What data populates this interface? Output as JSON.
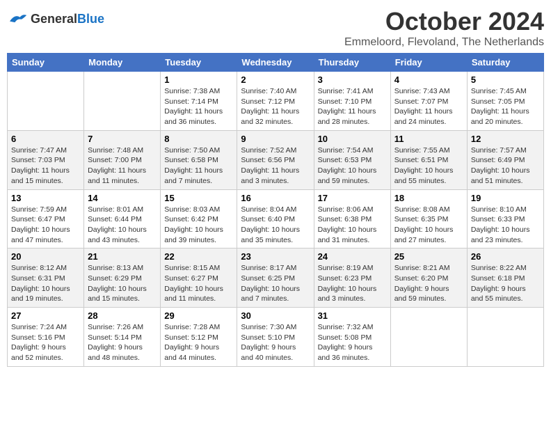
{
  "header": {
    "logo_general": "General",
    "logo_blue": "Blue",
    "month_title": "October 2024",
    "location": "Emmeloord, Flevoland, The Netherlands"
  },
  "days_of_week": [
    "Sunday",
    "Monday",
    "Tuesday",
    "Wednesday",
    "Thursday",
    "Friday",
    "Saturday"
  ],
  "weeks": [
    {
      "days": [
        {
          "num": "",
          "info": ""
        },
        {
          "num": "",
          "info": ""
        },
        {
          "num": "1",
          "info": "Sunrise: 7:38 AM\nSunset: 7:14 PM\nDaylight: 11 hours\nand 36 minutes."
        },
        {
          "num": "2",
          "info": "Sunrise: 7:40 AM\nSunset: 7:12 PM\nDaylight: 11 hours\nand 32 minutes."
        },
        {
          "num": "3",
          "info": "Sunrise: 7:41 AM\nSunset: 7:10 PM\nDaylight: 11 hours\nand 28 minutes."
        },
        {
          "num": "4",
          "info": "Sunrise: 7:43 AM\nSunset: 7:07 PM\nDaylight: 11 hours\nand 24 minutes."
        },
        {
          "num": "5",
          "info": "Sunrise: 7:45 AM\nSunset: 7:05 PM\nDaylight: 11 hours\nand 20 minutes."
        }
      ]
    },
    {
      "days": [
        {
          "num": "6",
          "info": "Sunrise: 7:47 AM\nSunset: 7:03 PM\nDaylight: 11 hours\nand 15 minutes."
        },
        {
          "num": "7",
          "info": "Sunrise: 7:48 AM\nSunset: 7:00 PM\nDaylight: 11 hours\nand 11 minutes."
        },
        {
          "num": "8",
          "info": "Sunrise: 7:50 AM\nSunset: 6:58 PM\nDaylight: 11 hours\nand 7 minutes."
        },
        {
          "num": "9",
          "info": "Sunrise: 7:52 AM\nSunset: 6:56 PM\nDaylight: 11 hours\nand 3 minutes."
        },
        {
          "num": "10",
          "info": "Sunrise: 7:54 AM\nSunset: 6:53 PM\nDaylight: 10 hours\nand 59 minutes."
        },
        {
          "num": "11",
          "info": "Sunrise: 7:55 AM\nSunset: 6:51 PM\nDaylight: 10 hours\nand 55 minutes."
        },
        {
          "num": "12",
          "info": "Sunrise: 7:57 AM\nSunset: 6:49 PM\nDaylight: 10 hours\nand 51 minutes."
        }
      ]
    },
    {
      "days": [
        {
          "num": "13",
          "info": "Sunrise: 7:59 AM\nSunset: 6:47 PM\nDaylight: 10 hours\nand 47 minutes."
        },
        {
          "num": "14",
          "info": "Sunrise: 8:01 AM\nSunset: 6:44 PM\nDaylight: 10 hours\nand 43 minutes."
        },
        {
          "num": "15",
          "info": "Sunrise: 8:03 AM\nSunset: 6:42 PM\nDaylight: 10 hours\nand 39 minutes."
        },
        {
          "num": "16",
          "info": "Sunrise: 8:04 AM\nSunset: 6:40 PM\nDaylight: 10 hours\nand 35 minutes."
        },
        {
          "num": "17",
          "info": "Sunrise: 8:06 AM\nSunset: 6:38 PM\nDaylight: 10 hours\nand 31 minutes."
        },
        {
          "num": "18",
          "info": "Sunrise: 8:08 AM\nSunset: 6:35 PM\nDaylight: 10 hours\nand 27 minutes."
        },
        {
          "num": "19",
          "info": "Sunrise: 8:10 AM\nSunset: 6:33 PM\nDaylight: 10 hours\nand 23 minutes."
        }
      ]
    },
    {
      "days": [
        {
          "num": "20",
          "info": "Sunrise: 8:12 AM\nSunset: 6:31 PM\nDaylight: 10 hours\nand 19 minutes."
        },
        {
          "num": "21",
          "info": "Sunrise: 8:13 AM\nSunset: 6:29 PM\nDaylight: 10 hours\nand 15 minutes."
        },
        {
          "num": "22",
          "info": "Sunrise: 8:15 AM\nSunset: 6:27 PM\nDaylight: 10 hours\nand 11 minutes."
        },
        {
          "num": "23",
          "info": "Sunrise: 8:17 AM\nSunset: 6:25 PM\nDaylight: 10 hours\nand 7 minutes."
        },
        {
          "num": "24",
          "info": "Sunrise: 8:19 AM\nSunset: 6:23 PM\nDaylight: 10 hours\nand 3 minutes."
        },
        {
          "num": "25",
          "info": "Sunrise: 8:21 AM\nSunset: 6:20 PM\nDaylight: 9 hours\nand 59 minutes."
        },
        {
          "num": "26",
          "info": "Sunrise: 8:22 AM\nSunset: 6:18 PM\nDaylight: 9 hours\nand 55 minutes."
        }
      ]
    },
    {
      "days": [
        {
          "num": "27",
          "info": "Sunrise: 7:24 AM\nSunset: 5:16 PM\nDaylight: 9 hours\nand 52 minutes."
        },
        {
          "num": "28",
          "info": "Sunrise: 7:26 AM\nSunset: 5:14 PM\nDaylight: 9 hours\nand 48 minutes."
        },
        {
          "num": "29",
          "info": "Sunrise: 7:28 AM\nSunset: 5:12 PM\nDaylight: 9 hours\nand 44 minutes."
        },
        {
          "num": "30",
          "info": "Sunrise: 7:30 AM\nSunset: 5:10 PM\nDaylight: 9 hours\nand 40 minutes."
        },
        {
          "num": "31",
          "info": "Sunrise: 7:32 AM\nSunset: 5:08 PM\nDaylight: 9 hours\nand 36 minutes."
        },
        {
          "num": "",
          "info": ""
        },
        {
          "num": "",
          "info": ""
        }
      ]
    }
  ]
}
